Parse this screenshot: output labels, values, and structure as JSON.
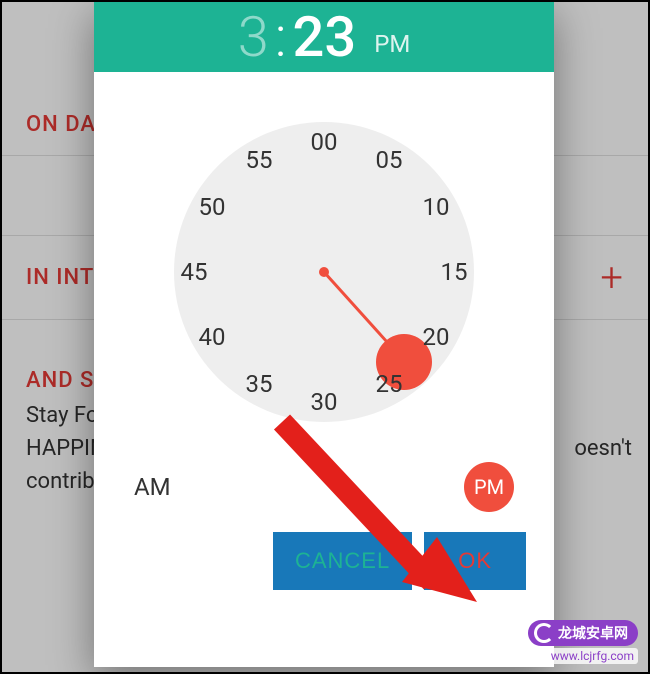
{
  "bg": {
    "section1": "ON DAY",
    "section2": "IN INTE",
    "section3": "AND SH",
    "body_line1": "Stay Foc",
    "body_line2": "HAPPIN",
    "body_line3": "contribu",
    "body_right": "oesn't"
  },
  "time": {
    "hour": "3",
    "colon": ":",
    "minute": "23",
    "period": "PM"
  },
  "clock": {
    "ticks": [
      "00",
      "05",
      "10",
      "15",
      "20",
      "25",
      "30",
      "35",
      "40",
      "45",
      "50",
      "55"
    ]
  },
  "ampm": {
    "am": "AM",
    "pm": "PM"
  },
  "buttons": {
    "cancel": "CANCEL",
    "ok": "OK"
  },
  "watermark": {
    "brand": "龙城安卓网",
    "url": "www.lcjrfg.com"
  }
}
